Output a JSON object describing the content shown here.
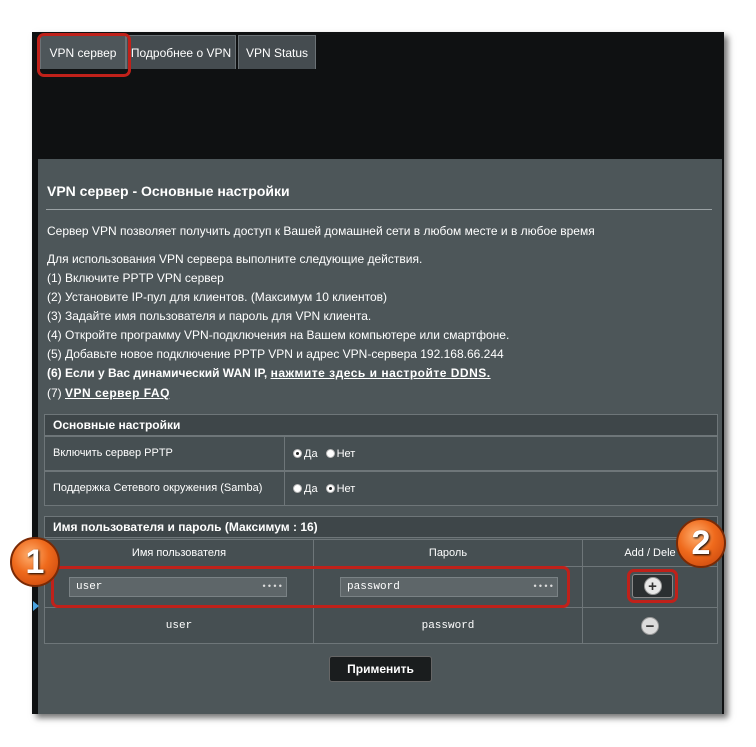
{
  "tabs": [
    {
      "label": "VPN сервер"
    },
    {
      "label": "Подробнее о VPN"
    },
    {
      "label": "VPN Status"
    }
  ],
  "page_title": "VPN сервер - Основные настройки",
  "description": "Сервер VPN позволяет получить доступ к Вашей домашней сети в любом месте и в любое время",
  "instructions_intro": "Для использования VPN сервера выполните следующие действия.",
  "steps": [
    "(1) Включите PPTP VPN сервер",
    "(2) Установите IP-пул для клиентов. (Максимум 10 клиентов)",
    "(3) Задайте имя пользователя и пароль для VPN клиента.",
    "(4) Откройте программу VPN-подключения на Вашем компьютере или смартфоне.",
    "(5) Добавьте новое подключение PPTP VPN и адрес VPN-сервера 192.168.66.244"
  ],
  "step6_prefix": "(6) Если у Вас динамический WAN IP, ",
  "step6_link": "нажмите здесь и настройте DDNS.",
  "step7_prefix": "(7) ",
  "step7_link": "VPN сервер FAQ",
  "basic_section": {
    "header": "Основные настройки",
    "rows": [
      {
        "label": "Включить сервер PPTP",
        "opt_yes": "Да",
        "opt_no": "Нет",
        "selected": "yes"
      },
      {
        "label": "Поддержка Сетевого окружения (Samba)",
        "opt_yes": "Да",
        "opt_no": "Нет",
        "selected": "no"
      }
    ]
  },
  "user_section": {
    "header": "Имя пользователя и пароль (Максимум : 16)",
    "col_user": "Имя пользователя",
    "col_pass": "Пароль",
    "col_action": "Add / Dele",
    "input_user": "user",
    "input_pass": "password",
    "entries": [
      {
        "user": "user",
        "password": "password"
      }
    ]
  },
  "apply_label": "Применить",
  "badges": [
    "1",
    "2"
  ],
  "colors": {
    "highlight": "#c0211a",
    "badge": "#ef6a1c",
    "panel": "#4d5659"
  }
}
